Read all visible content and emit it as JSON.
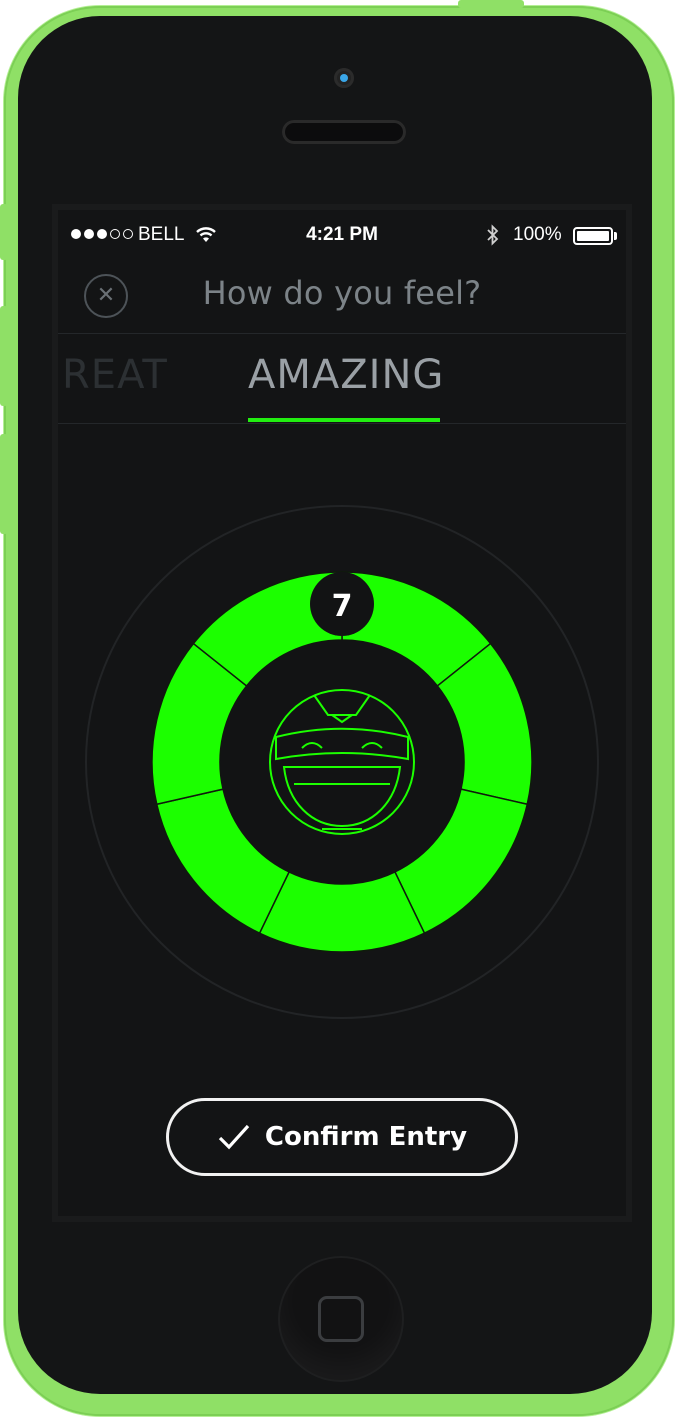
{
  "device": {
    "frame_color": "#8fe066",
    "face_color": "#141516",
    "home_button_icon": "home-square-icon"
  },
  "status_bar": {
    "carrier": "BELL",
    "time": "4:21 PM",
    "battery_percent": "100%",
    "signal_bars_filled": 3,
    "signal_bars_total": 5,
    "icons": [
      "signal-dots-icon",
      "wifi-icon",
      "bluetooth-icon",
      "battery-icon"
    ]
  },
  "header": {
    "title": "How do you feel?",
    "close_icon": "close-icon"
  },
  "mood_tabs": {
    "previous": "GREAT",
    "current": "AMAZING",
    "accent_color": "#22ee11"
  },
  "mood_dial": {
    "score": "7",
    "level": 7,
    "max_level": 7,
    "ring_color": "#1cff00",
    "face_icon": "happy-robot-face-icon"
  },
  "confirm_button": {
    "label": "Confirm Entry",
    "icon": "check-icon"
  }
}
